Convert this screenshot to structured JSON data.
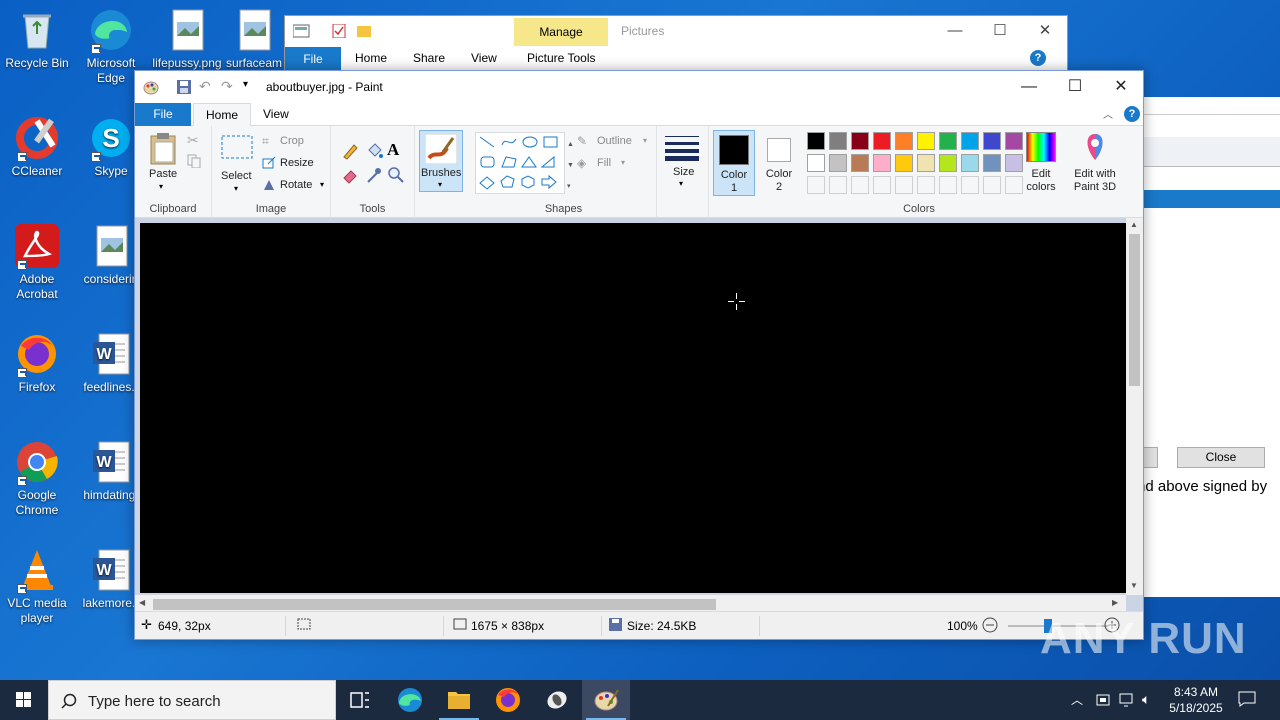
{
  "desktop": {
    "icons": [
      {
        "label": "Recycle Bin"
      },
      {
        "label": "Microsoft Edge"
      },
      {
        "label": "lifepussy.png"
      },
      {
        "label": "surfaceam"
      },
      {
        "label": "CCleaner"
      },
      {
        "label": "Skype"
      },
      {
        "label": "Adobe Acrobat"
      },
      {
        "label": "considerin"
      },
      {
        "label": "Firefox"
      },
      {
        "label": "feedlines.r"
      },
      {
        "label": "Google Chrome"
      },
      {
        "label": "himdating."
      },
      {
        "label": "VLC media player"
      },
      {
        "label": "lakemore.r"
      }
    ]
  },
  "explorer": {
    "title": "Pictures",
    "manage_label": "Manage",
    "tabs": [
      "File",
      "Home",
      "Share",
      "View",
      "Picture Tools"
    ]
  },
  "background_dialog": {
    "close_label": "Close",
    "fragment_text": "nd above signed by"
  },
  "paint": {
    "title": "aboutbuyer.jpg - Paint",
    "menu": {
      "file": "File",
      "home": "Home",
      "view": "View"
    },
    "ribbon": {
      "clipboard": {
        "label": "Clipboard",
        "paste": "Paste"
      },
      "image": {
        "label": "Image",
        "select": "Select",
        "crop": "Crop",
        "resize": "Resize",
        "rotate": "Rotate"
      },
      "tools": {
        "label": "Tools"
      },
      "brushes": {
        "label": "Brushes"
      },
      "shapes": {
        "label": "Shapes",
        "outline": "Outline",
        "fill": "Fill"
      },
      "size": {
        "label": "Size"
      },
      "colors": {
        "label": "Colors",
        "color1": "Color 1",
        "color2": "Color 2",
        "edit_colors": "Edit colors",
        "edit_paint3d": "Edit with Paint 3D",
        "color1_value": "#000000",
        "color2_value": "#ffffff",
        "palette_row1": [
          "#000000",
          "#7f7f7f",
          "#880015",
          "#ed1c24",
          "#ff7f27",
          "#fff200",
          "#22b14c",
          "#00a2e8",
          "#3f48cc",
          "#a349a4"
        ],
        "palette_row2": [
          "#ffffff",
          "#c3c3c3",
          "#b97a57",
          "#ffaec9",
          "#ffc90e",
          "#efe4b0",
          "#b5e61d",
          "#99d9ea",
          "#7092be",
          "#c8bfe7"
        ],
        "palette_row3": [
          "#f5f6f7",
          "#f5f6f7",
          "#f5f6f7",
          "#f5f6f7",
          "#f5f6f7",
          "#f5f6f7",
          "#f5f6f7",
          "#f5f6f7",
          "#f5f6f7",
          "#f5f6f7"
        ]
      }
    },
    "status": {
      "cursor_pos": "649, 32px",
      "image_size": "1675 × 838px",
      "file_size": "Size: 24.5KB",
      "zoom": "100%"
    }
  },
  "taskbar": {
    "search_placeholder": "Type here to search",
    "time": "8:43 AM",
    "date": "5/18/2025"
  },
  "watermark": "ANY RUN"
}
